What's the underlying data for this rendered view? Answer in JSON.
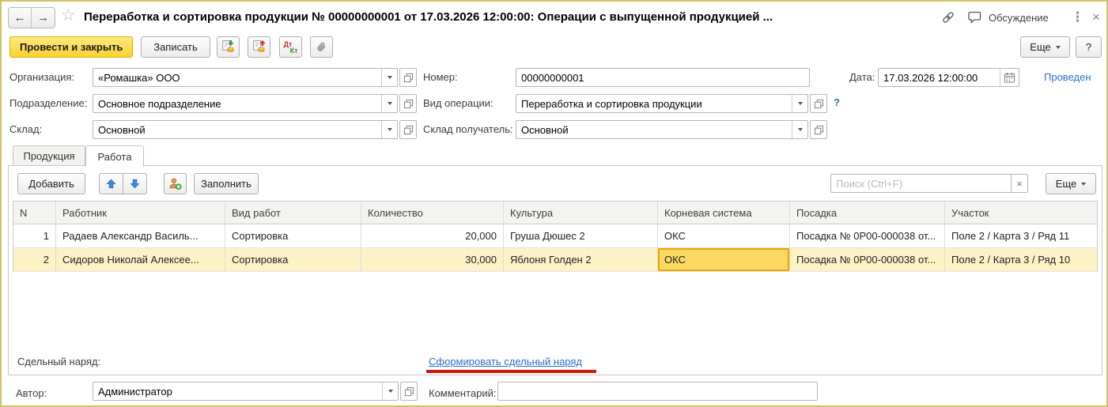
{
  "window": {
    "title": "Переработка и сортировка продукции № 00000000001 от 17.03.2026 12:00:00: Операции с выпущенной продукцией ...",
    "discussion": "Обсуждение"
  },
  "icons": {
    "nav_back": "←",
    "nav_forward": "→",
    "star": "☆",
    "kebab": "⋮",
    "close": "×",
    "clear": "×",
    "debit": "Дт",
    "credit": "Кт"
  },
  "command_bar": {
    "post_and_close": "Провести и закрыть",
    "write": "Записать",
    "more": "Еще",
    "help": "?"
  },
  "form": {
    "organization": {
      "label": "Организация:",
      "value": "«Ромашка» ООО"
    },
    "department": {
      "label": "Подразделение:",
      "value": "Основное подразделение"
    },
    "warehouse": {
      "label": "Склад:",
      "value": "Основной"
    },
    "number": {
      "label": "Номер:",
      "value": "00000000001"
    },
    "operation_kind": {
      "label": "Вид операции:",
      "value": "Переработка и сортировка продукции",
      "help": "?"
    },
    "warehouse_receiver": {
      "label": "Склад получатель:",
      "value": "Основной"
    },
    "date": {
      "label": "Дата:",
      "value": "17.03.2026 12:00:00"
    },
    "status": "Проведен"
  },
  "tabs": [
    {
      "label": "Продукция"
    },
    {
      "label": "Работа"
    }
  ],
  "grid": {
    "toolbar": {
      "add": "Добавить",
      "fill": "Заполнить",
      "search_placeholder": "Поиск (Ctrl+F)",
      "more": "Еще"
    },
    "columns": [
      "N",
      "Работник",
      "Вид работ",
      "Количество",
      "Культура",
      "Корневая система",
      "Посадка",
      "Участок"
    ],
    "rows": [
      {
        "n": "1",
        "worker": "Радаев Александр Василь...",
        "work_type": "Сортировка",
        "quantity": "20,000",
        "culture": "Груша Дюшес 2",
        "root_system": "ОКС",
        "planting": "Посадка № 0Р00-000038 от...",
        "plot": "Поле 2 / Карта 3 / Ряд 11"
      },
      {
        "n": "2",
        "worker": "Сидоров Николай Алексее...",
        "work_type": "Сортировка",
        "quantity": "30,000",
        "culture": "Яблоня Голден 2",
        "root_system": "ОКС",
        "planting": "Посадка № 0Р00-000038 от...",
        "plot": "Поле 2 / Карта 3 / Ряд 10"
      }
    ]
  },
  "piecework": {
    "label": "Сдельный наряд:",
    "link": "Сформировать сдельный наряд"
  },
  "footer": {
    "author": {
      "label": "Автор:",
      "value": "Администратор"
    },
    "comment": {
      "label": "Комментарий:",
      "value": ""
    }
  },
  "colors": {
    "frame_border": "#cfc463",
    "accent_button": "#fbd231",
    "link_blue": "#2a6fc9",
    "status_blue": "#2a6fc9",
    "selected_row_bg": "#fcf2c6",
    "active_cell_bg": "#fbd862",
    "active_cell_border": "#eda500",
    "annotation_red": "#c9170f"
  }
}
